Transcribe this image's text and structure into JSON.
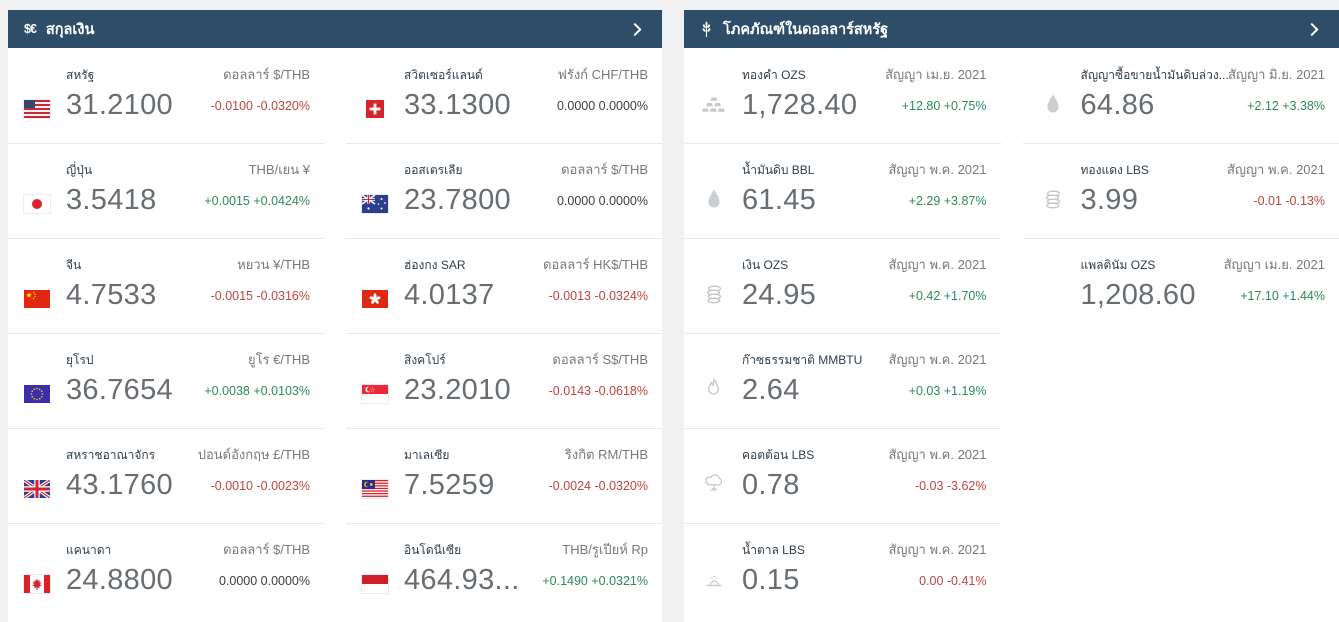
{
  "colors": {
    "header_bg": "#2e4d68",
    "panel_bg": "#ffffff",
    "page_bg": "#f1f1f2",
    "positive": "#2c8a5b",
    "negative": "#c2443e",
    "neutral": "#3d3d3d",
    "value_text": "#686d71"
  },
  "panels": [
    {
      "id": "currencies",
      "title": "สกุลเงิน",
      "header_icon": "currency-dollar-euro-icon",
      "header_icon_glyph": "$€",
      "rows": [
        [
          {
            "icon": "flag-us",
            "name": "สหรัฐ",
            "value": "31.2100",
            "label": "ดอลลาร์ $/THB",
            "change": "-0.0100 -0.0320%",
            "trend": "down"
          },
          {
            "icon": "flag-ch",
            "name": "สวิตเซอร์แลนด์",
            "value": "33.1300",
            "label": "ฟรังก์ CHF/THB",
            "change": "0.0000 0.0000%",
            "trend": "flat"
          }
        ],
        [
          {
            "icon": "flag-jp",
            "name": "ญี่ปุ่น",
            "value": "3.5418",
            "label": "THB/เยน ¥",
            "change": "+0.0015 +0.0424%",
            "trend": "up"
          },
          {
            "icon": "flag-au",
            "name": "ออสเตรเลีย",
            "value": "23.7800",
            "label": "ดอลลาร์ $/THB",
            "change": "0.0000 0.0000%",
            "trend": "flat"
          }
        ],
        [
          {
            "icon": "flag-cn",
            "name": "จีน",
            "value": "4.7533",
            "label": "หยวน ¥/THB",
            "change": "-0.0015 -0.0316%",
            "trend": "down"
          },
          {
            "icon": "flag-hk",
            "name": "ฮ่องกง SAR",
            "value": "4.0137",
            "label": "ดอลลาร์ HK$/THB",
            "change": "-0.0013 -0.0324%",
            "trend": "down"
          }
        ],
        [
          {
            "icon": "flag-eu",
            "name": "ยุโรป",
            "value": "36.7654",
            "label": "ยูโร €/THB",
            "change": "+0.0038 +0.0103%",
            "trend": "up"
          },
          {
            "icon": "flag-sg",
            "name": "สิงคโปร์",
            "value": "23.2010",
            "label": "ดอลลาร์ S$/THB",
            "change": "-0.0143 -0.0618%",
            "trend": "down"
          }
        ],
        [
          {
            "icon": "flag-gb",
            "name": "สหราชอาณาจักร",
            "value": "43.1760",
            "label": "ปอนด์อังกฤษ £/THB",
            "change": "-0.0010 -0.0023%",
            "trend": "down"
          },
          {
            "icon": "flag-my",
            "name": "มาเลเซีย",
            "value": "7.5259",
            "label": "ริงกิต RM/THB",
            "change": "-0.0024 -0.0320%",
            "trend": "down"
          }
        ],
        [
          {
            "icon": "flag-ca",
            "name": "แคนาดา",
            "value": "24.8800",
            "label": "ดอลลาร์ $/THB",
            "change": "0.0000 0.0000%",
            "trend": "flat"
          },
          {
            "icon": "flag-id",
            "name": "อินโดนีเซีย",
            "value": "464.93...",
            "label": "THB/รูเปียห์ Rp",
            "change": "+0.1490 +0.0321%",
            "trend": "up"
          }
        ]
      ]
    },
    {
      "id": "commodities",
      "title": "โภคภัณฑ์ในดอลลาร์สหรัฐ",
      "header_icon": "wheat-icon",
      "header_icon_glyph": "",
      "rows": [
        [
          {
            "icon": "gold-bars",
            "name": "ทองคำ OZS",
            "value": "1,728.40",
            "label": "สัญญา เม.ย. 2021",
            "change": "+12.80 +0.75%",
            "trend": "up"
          },
          {
            "icon": "oil-drop",
            "name": "สัญญาซื้อขายน้ำมันดิบล่วง...",
            "value": "64.86",
            "label": "สัญญา มิ.ย. 2021",
            "change": "+2.12 +3.38%",
            "trend": "up"
          }
        ],
        [
          {
            "icon": "oil-drop",
            "name": "น้ำมันดิบ BBL",
            "value": "61.45",
            "label": "สัญญา พ.ค. 2021",
            "change": "+2.29 +3.87%",
            "trend": "up"
          },
          {
            "icon": "coins-stack",
            "name": "ทองแดง LBS",
            "value": "3.99",
            "label": "สัญญา พ.ค. 2021",
            "change": "-0.01 -0.13%",
            "trend": "down"
          }
        ],
        [
          {
            "icon": "coins-stack",
            "name": "เงิน OZS",
            "value": "24.95",
            "label": "สัญญา พ.ค. 2021",
            "change": "+0.42 +1.70%",
            "trend": "up"
          },
          {
            "icon": null,
            "name": "แพลตินัม OZS",
            "value": "1,208.60",
            "label": "สัญญา เม.ย. 2021",
            "change": "+17.10 +1.44%",
            "trend": "up"
          }
        ],
        [
          {
            "icon": "flame",
            "name": "ก๊าซธรรมชาติ MMBTU",
            "value": "2.64",
            "label": "สัญญา พ.ค. 2021",
            "change": "+0.03 +1.19%",
            "trend": "up"
          },
          {
            "empty": true
          }
        ],
        [
          {
            "icon": "cotton",
            "name": "คอตต้อน LBS",
            "value": "0.78",
            "label": "สัญญา พ.ค. 2021",
            "change": "-0.03 -3.62%",
            "trend": "down"
          },
          {
            "empty": true
          }
        ],
        [
          {
            "icon": "sugar",
            "name": "น้ำตาล LBS",
            "value": "0.15",
            "label": "สัญญา พ.ค. 2021",
            "change": "0.00 -0.41%",
            "trend": "down"
          },
          {
            "empty": true
          }
        ]
      ]
    }
  ]
}
